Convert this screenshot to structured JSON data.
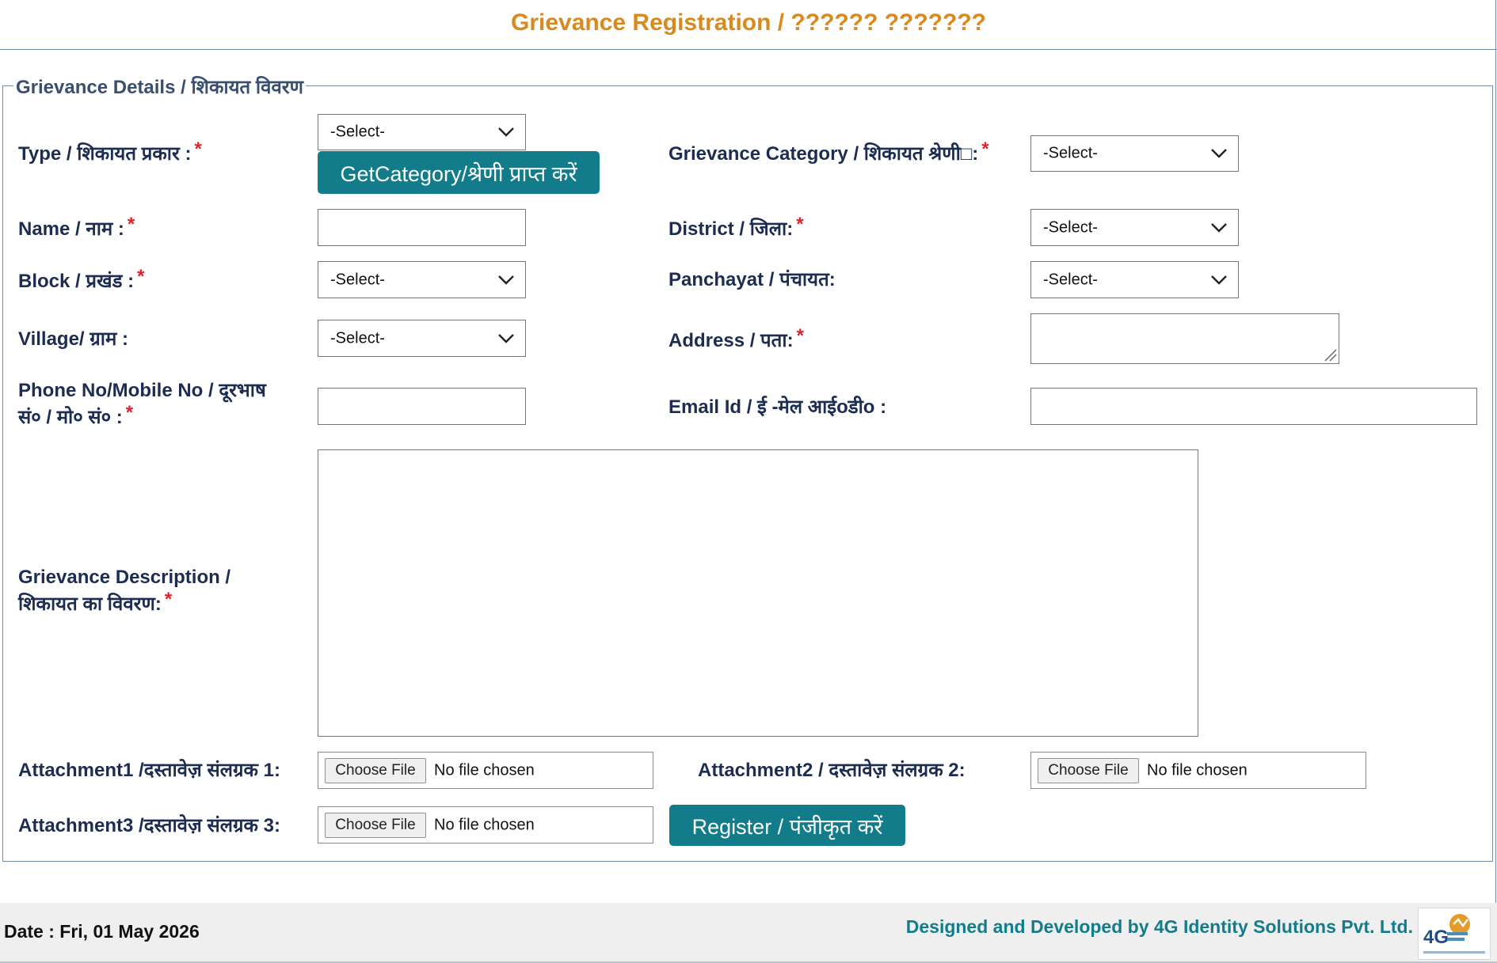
{
  "header": {
    "title": "Grievance Registration / ?????? ???????"
  },
  "form": {
    "legend": "Grievance Details / शिकायत विवरण",
    "required_mark": "*",
    "type": {
      "label": "Type / शिकायत प्रकार :",
      "value": "-Select-"
    },
    "get_category_button": "GetCategory/श्रेणी प्राप्त करें",
    "category": {
      "label": "Grievance Category / शिकायत श्रेणी□:",
      "value": "-Select-"
    },
    "name": {
      "label": "Name / नाम :",
      "value": ""
    },
    "district": {
      "label": "District / जिला:",
      "value": "-Select-"
    },
    "block": {
      "label": "Block / प्रखंड :",
      "value": "-Select-"
    },
    "panchayat": {
      "label": "Panchayat / पंचायत:",
      "value": "-Select-"
    },
    "village": {
      "label": "Village/ ग्राम :",
      "value": "-Select-"
    },
    "address": {
      "label": "Address / पता:",
      "value": ""
    },
    "phone": {
      "label_line1": "Phone No/Mobile No / दूरभाष",
      "label_line2": "सं० / मो० सं० :",
      "value": ""
    },
    "email": {
      "label": "Email Id / ई -मेल आईoडीo :",
      "value": ""
    },
    "description": {
      "label_line1": "Grievance Description /",
      "label_line2": "शिकायत का विवरण:",
      "value": ""
    },
    "attachment1": {
      "label": "Attachment1 /दस्तावेज़ संलग्रक 1:",
      "button": "Choose File",
      "status": "No file chosen"
    },
    "attachment2": {
      "label": "Attachment2 / दस्तावेज़ संलग्रक 2:",
      "button": "Choose File",
      "status": "No file chosen"
    },
    "attachment3": {
      "label": "Attachment3 /दस्तावेज़ संलग्रक 3:",
      "button": "Choose File",
      "status": "No file chosen"
    },
    "register_button": "Register / पंजीकृत करें"
  },
  "footer": {
    "date": "Date : Fri, 01 May 2026",
    "credit": "Designed and Developed by 4G Identity Solutions Pvt. Ltd.",
    "logo_text": "4G"
  },
  "colors": {
    "title": "#d98a1f",
    "label": "#1c2c52",
    "required": "#e0202a",
    "button": "#137c8b",
    "credit": "#137c8b",
    "border": "#6f8ca8"
  },
  "icons": {
    "select_arrow": "chevron-down-icon",
    "textarea_resize": "resize-grip-icon",
    "logo": "company-logo"
  }
}
